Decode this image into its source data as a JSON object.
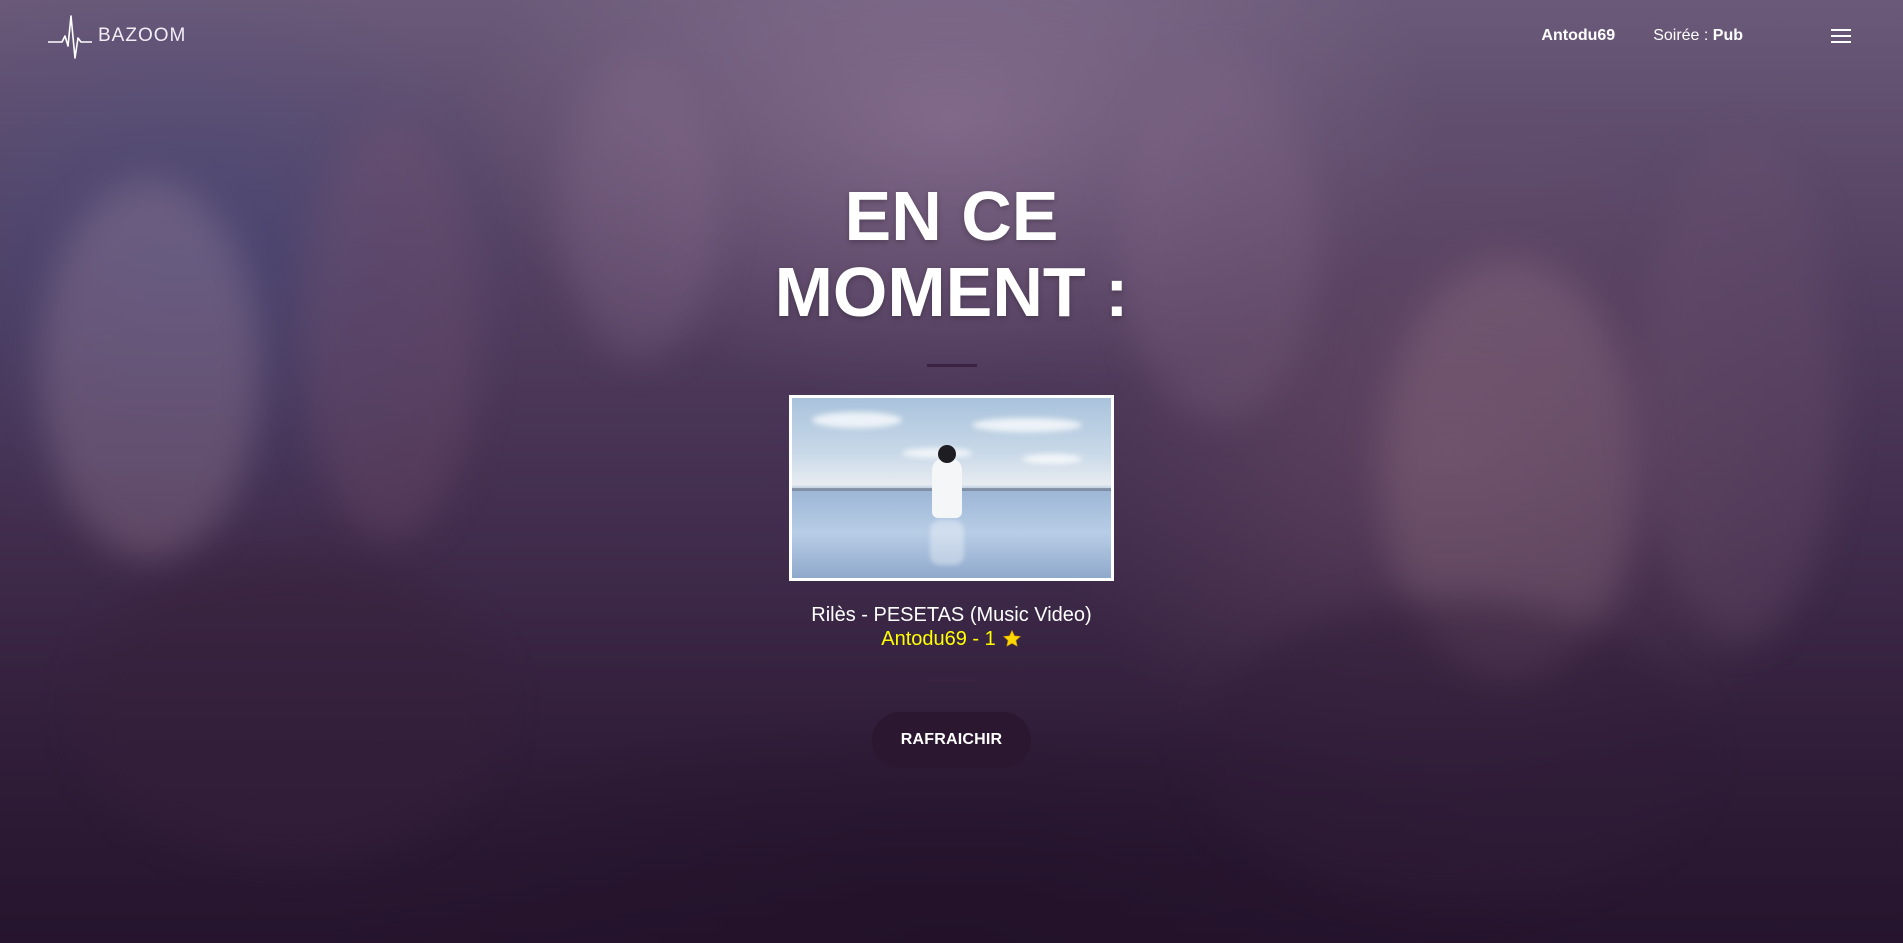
{
  "brand": {
    "name": "BAZOOM"
  },
  "nav": {
    "username": "Antodu69",
    "soiree_label": "Soirée : ",
    "soiree_value": "Pub"
  },
  "hero": {
    "title": "EN CE MOMENT :",
    "track_title": "Rilès - PESETAS (Music Video)",
    "submitter": "Antodu69 - 1",
    "refresh_label": "RAFRAICHIR"
  },
  "icons": {
    "logo": "heartbeat-pulse-icon",
    "menu": "hamburger-menu-icon",
    "star": "star-icon"
  },
  "colors": {
    "accent_yellow": "#ffff00",
    "button_bg": "#2c1730",
    "divider": "#3a2340"
  }
}
